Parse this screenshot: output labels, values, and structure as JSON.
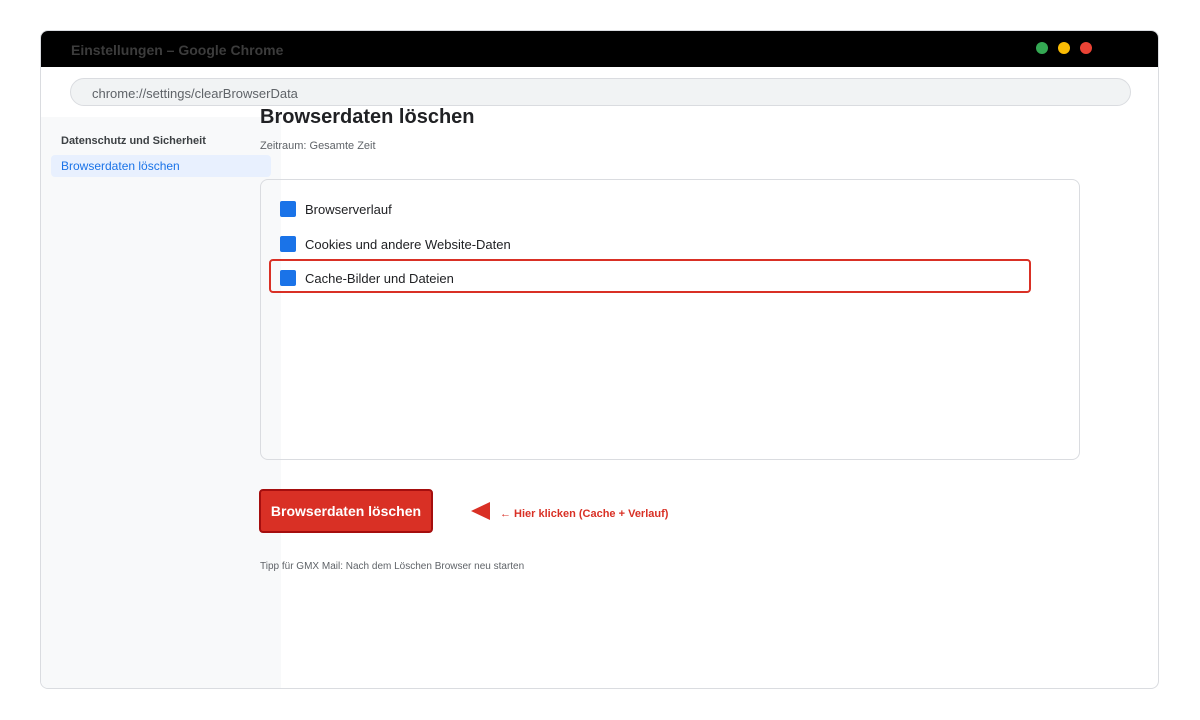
{
  "window": {
    "title": "Einstellungen – Google Chrome"
  },
  "address_bar": {
    "url": "chrome://settings/clearBrowserData"
  },
  "sidebar": {
    "heading": "Datenschutz und Sicherheit",
    "items": [
      {
        "label": "Browserdaten löschen",
        "active": true
      }
    ]
  },
  "main": {
    "title": "Browserdaten löschen",
    "subtitle": "Zeitraum: Gesamte Zeit",
    "options": [
      {
        "label": "Browserverlauf",
        "checked": true
      },
      {
        "label": "Cookies und andere Website-Daten",
        "checked": true
      },
      {
        "label": "Cache-Bilder und Dateien",
        "checked": true,
        "highlighted": true
      }
    ],
    "clear_button": "Browserdaten löschen",
    "hint": "← Hier klicken (Cache + Verlauf)",
    "tip": "Tipp für GMX Mail: Nach dem Löschen Browser neu starten"
  },
  "colors": {
    "accent": "#1a73e8",
    "danger": "#d93025",
    "titlebar": "#000000"
  },
  "icons": {
    "window_controls": [
      "minimize-dot-green",
      "maximize-dot-yellow",
      "close-dot-red"
    ],
    "pointer": "left-triangle-arrow"
  }
}
